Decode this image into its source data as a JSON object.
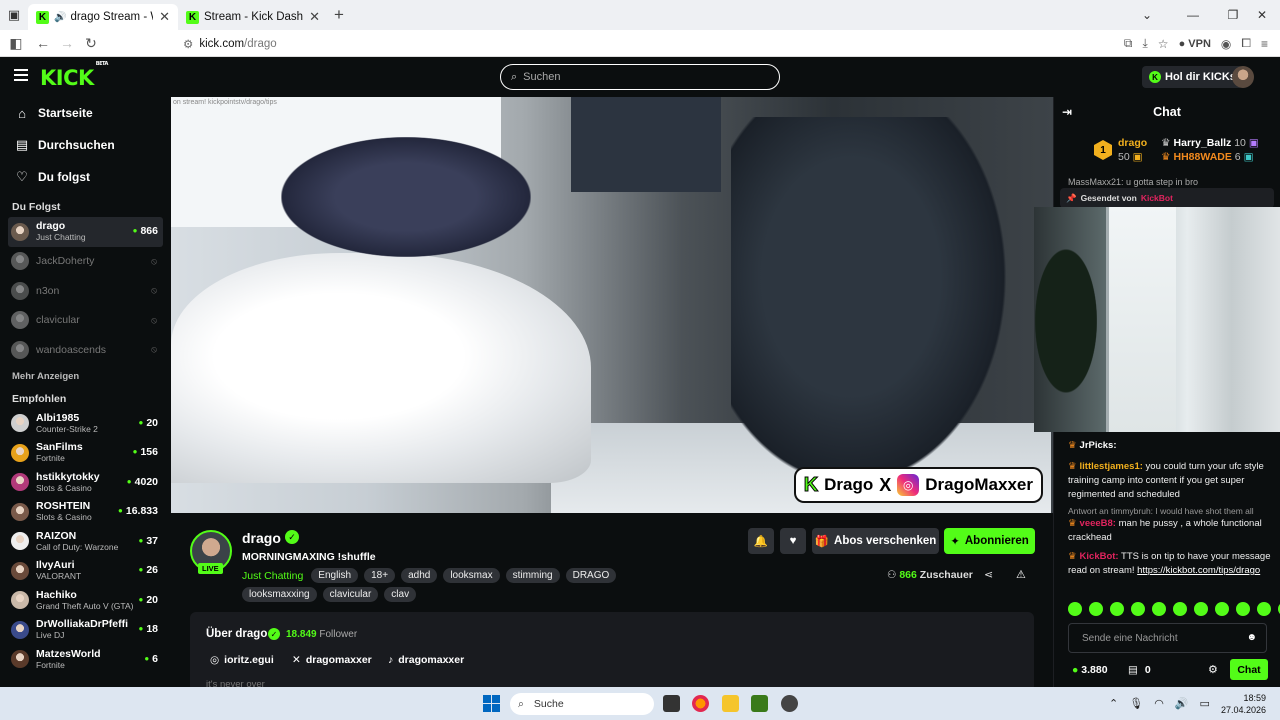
{
  "browser": {
    "tabs": [
      {
        "title": "drago Stream - Watch Live",
        "audio": true,
        "active": true
      },
      {
        "title": "Stream - Kick Dashboard",
        "audio": false,
        "active": false
      }
    ],
    "url_host": "kick.com",
    "url_path": "/drago",
    "vpn_label": "VPN"
  },
  "header": {
    "logo": "KICK",
    "logo_badge": "BETA",
    "search_placeholder": "Suchen",
    "get_kicks_label": "Hol dir KICKs"
  },
  "sidebar": {
    "nav": [
      {
        "label": "Startseite",
        "icon": "home-icon"
      },
      {
        "label": "Durchsuchen",
        "icon": "browse-icon"
      },
      {
        "label": "Du folgst",
        "icon": "heart-icon"
      }
    ],
    "following_title": "Du Folgst",
    "following": [
      {
        "name": "drago",
        "sub": "Just Chatting",
        "viewers": "866",
        "live": true,
        "color": "#6b5b4e"
      },
      {
        "name": "JackDoherty",
        "live": false,
        "color": "#8a8a8a"
      },
      {
        "name": "n3on",
        "live": false,
        "color": "#777777"
      },
      {
        "name": "clavicular",
        "live": false,
        "color": "#999999"
      },
      {
        "name": "wandoascends",
        "live": false,
        "color": "#888888"
      }
    ],
    "show_more": "Mehr Anzeigen",
    "recommended_title": "Empfohlen",
    "recommended": [
      {
        "name": "Albi1985",
        "sub": "Counter-Strike 2",
        "viewers": "20",
        "color": "#cfcfcf"
      },
      {
        "name": "SanFilms",
        "sub": "Fortnite",
        "viewers": "156",
        "color": "#e8a21a"
      },
      {
        "name": "hstikkytokky",
        "sub": "Slots & Casino",
        "viewers": "4020",
        "color": "#b23a7a"
      },
      {
        "name": "ROSHTEIN",
        "sub": "Slots & Casino",
        "viewers": "16.833",
        "color": "#7a5a4a"
      },
      {
        "name": "RAIZON",
        "sub": "Call of Duty: Warzone",
        "viewers": "37",
        "color": "#eeeeee"
      },
      {
        "name": "IlvyAuri",
        "sub": "VALORANT",
        "viewers": "26",
        "color": "#6a4a3a"
      },
      {
        "name": "Hachiko",
        "sub": "Grand Theft Auto V (GTA)",
        "viewers": "20",
        "color": "#c9b8a8"
      },
      {
        "name": "DrWolliakaDrPfeffi",
        "sub": "Live DJ",
        "viewers": "18",
        "color": "#3a4a8a"
      },
      {
        "name": "MatzesWorld",
        "sub": "Fortnite",
        "viewers": "6",
        "color": "#5a3a2a"
      }
    ]
  },
  "video": {
    "watermark": "on stream! kickpointstv/drago/tips",
    "overlay_kick": "K",
    "overlay_name": "Drago",
    "overlay_x": "X",
    "overlay_ig": "DragoMaxxer"
  },
  "stream": {
    "live_label": "LIVE",
    "name": "drago",
    "title": "MORNINGMAXING !shuffle",
    "category": "Just Chatting",
    "tags": [
      "English",
      "18+",
      "adhd",
      "looksmax",
      "stimming",
      "DRAGO",
      "looksmaxxing",
      "clavicular",
      "clav"
    ],
    "gift_subs_label": "Abos verschenken",
    "subscribe_label": "Abonnieren",
    "viewers_count": "866",
    "viewers_label": "Zuschauer"
  },
  "about": {
    "heading": "Über drago",
    "followers_count": "18.849",
    "followers_label": "Follower",
    "instagram": "ioritz.egui",
    "x": "dragomaxxer",
    "tiktok": "dragomaxxer",
    "bio": "it's never over"
  },
  "chat": {
    "title": "Chat",
    "leaderboard": {
      "rank": "1",
      "first_name": "drago",
      "first_points": "50",
      "second_name": "Harry_Ballz",
      "second_points": "10",
      "third_name": "HH88WADE",
      "third_points": "6"
    },
    "partial_message": "MassMaxx21: u gotta step in bro",
    "pinned_label": "Gesendet von",
    "pinned_by": "KickBot",
    "messages": [
      {
        "user": "JrPicks:",
        "text": "",
        "color": "#ffffff"
      },
      {
        "user": "littlestjames1:",
        "text": " you could turn your ufc style training camp into content if you get super regimented and scheduled",
        "color": "#f2b01e"
      },
      {
        "reply": "Antwort an timmybruh: I would have shot them all",
        "user": "veeeB8:",
        "text": " man he pussy , a whole functional crackhead",
        "color": "#e0245e"
      },
      {
        "user": "KickBot:",
        "text": " TTS is on tip to have your message read on stream! ",
        "link": "https://kickbot.com/tips/drago",
        "color": "#e0245e"
      }
    ],
    "input_placeholder": "Sende eine Nachricht",
    "points": "3.880",
    "gifts": "0",
    "send_label": "Chat"
  },
  "taskbar": {
    "search_label": "Suche",
    "time": "18:59",
    "date": "27.04.2026"
  },
  "colors": {
    "kick_green": "#53fc18",
    "bg": "#0b0e0f",
    "panel": "#191b1f"
  }
}
